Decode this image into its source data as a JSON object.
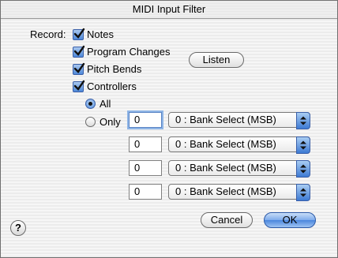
{
  "window": {
    "title": "MIDI Input Filter"
  },
  "record": {
    "label": "Record:",
    "options": [
      {
        "label": "Notes",
        "checked": true
      },
      {
        "label": "Program Changes",
        "checked": true
      },
      {
        "label": "Pitch Bends",
        "checked": true
      },
      {
        "label": "Controllers",
        "checked": true
      }
    ]
  },
  "controllers": {
    "all_label": "All",
    "only_label": "Only",
    "selected": "All",
    "rows": [
      {
        "number": "0",
        "controller": "0 : Bank Select (MSB)"
      },
      {
        "number": "0",
        "controller": "0 : Bank Select (MSB)"
      },
      {
        "number": "0",
        "controller": "0 : Bank Select (MSB)"
      },
      {
        "number": "0",
        "controller": "0 : Bank Select (MSB)"
      }
    ]
  },
  "buttons": {
    "listen": "Listen",
    "cancel": "Cancel",
    "ok": "OK",
    "help": "?"
  },
  "colors": {
    "accent": "#4d88d9",
    "window_bg": "#ececec"
  }
}
